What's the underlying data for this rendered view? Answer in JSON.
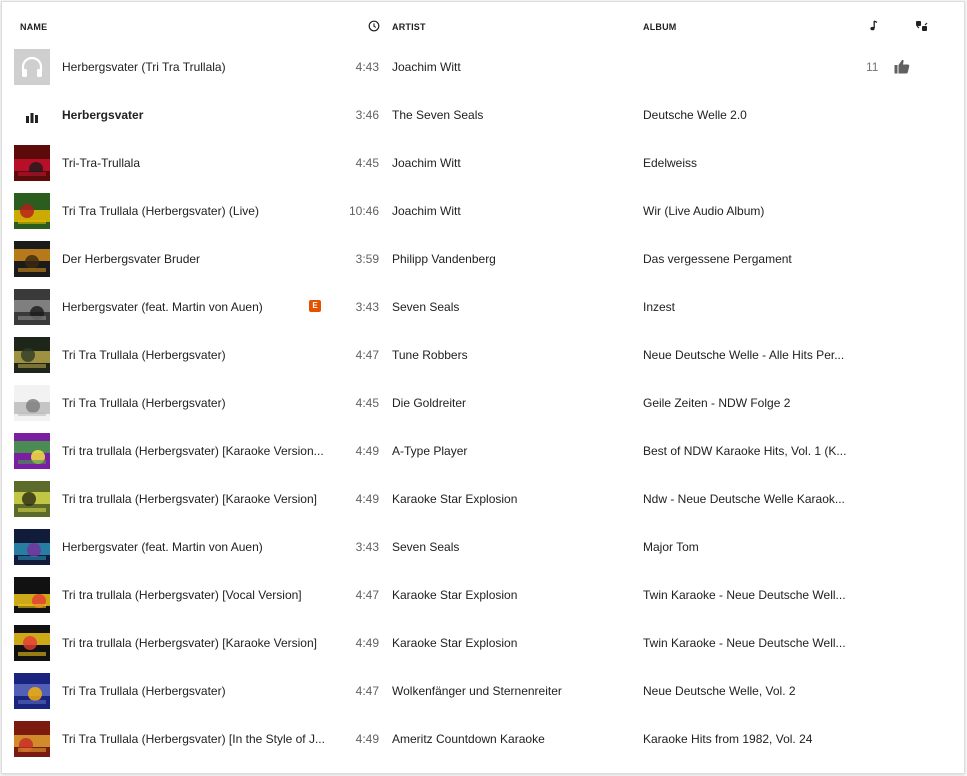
{
  "header": {
    "name_label": "NAME",
    "duration_icon": "clock-icon",
    "artist_label": "ARTIST",
    "album_label": "ALBUM",
    "plays_icon": "music-note-icon",
    "likes_icon": "thumbs-up-down-icon"
  },
  "rows": [
    {
      "name": "Herbergsvater (Tri Tra Trullala)",
      "duration": "4:43",
      "artist": "Joachim Witt",
      "album": "",
      "count": "11",
      "thumb": "headphones-placeholder"
    },
    {
      "name": "Herbergsvater",
      "duration": "3:46",
      "artist": "The Seven Seals",
      "album": "Deutsche Welle 2.0",
      "thumb": "equalizer-now-playing"
    },
    {
      "name": "Tri-Tra-Trullala",
      "duration": "4:45",
      "artist": "Joachim Witt",
      "album": "Edelweiss",
      "thumb": "album-art"
    },
    {
      "name": "Tri Tra Trullala (Herbergsvater) (Live)",
      "duration": "10:46",
      "artist": "Joachim Witt",
      "album": "Wir (Live Audio Album)",
      "thumb": "album-art"
    },
    {
      "name": "Der Herbergsvater Bruder",
      "duration": "3:59",
      "artist": "Philipp Vandenberg",
      "album": "Das vergessene Pergament",
      "thumb": "album-art"
    },
    {
      "name": "Herbergsvater (feat. Martin von Auen)",
      "duration": "3:43",
      "artist": "Seven Seals",
      "album": "Inzest",
      "explicit": "E",
      "thumb": "album-art"
    },
    {
      "name": "Tri Tra Trullala (Herbergsvater)",
      "duration": "4:47",
      "artist": "Tune Robbers",
      "album": "Neue Deutsche Welle - Alle Hits Per...",
      "thumb": "album-art"
    },
    {
      "name": "Tri Tra Trullala (Herbergsvater)",
      "duration": "4:45",
      "artist": "Die Goldreiter",
      "album": "Geile Zeiten - NDW Folge 2",
      "thumb": "album-art"
    },
    {
      "name": "Tri tra trullala (Herbergsvater) [Karaoke Version...",
      "duration": "4:49",
      "artist": "A-Type Player",
      "album": "Best of NDW Karaoke Hits, Vol. 1 (K...",
      "thumb": "album-art"
    },
    {
      "name": "Tri tra trullala (Herbergsvater) [Karaoke Version]",
      "duration": "4:49",
      "artist": "Karaoke Star Explosion",
      "album": "Ndw - Neue Deutsche Welle Karaok...",
      "thumb": "album-art"
    },
    {
      "name": "Herbergsvater (feat. Martin von Auen)",
      "duration": "3:43",
      "artist": "Seven Seals",
      "album": "Major Tom",
      "thumb": "album-art"
    },
    {
      "name": "Tri tra trullala (Herbergsvater) [Vocal Version]",
      "duration": "4:47",
      "artist": "Karaoke Star Explosion",
      "album": "Twin Karaoke - Neue Deutsche Well...",
      "thumb": "album-art"
    },
    {
      "name": "Tri tra trullala (Herbergsvater) [Karaoke Version]",
      "duration": "4:49",
      "artist": "Karaoke Star Explosion",
      "album": "Twin Karaoke - Neue Deutsche Well...",
      "thumb": "album-art"
    },
    {
      "name": "Tri Tra Trullala (Herbergsvater)",
      "duration": "4:47",
      "artist": "Wolkenfänger und Sternenreiter",
      "album": "Neue Deutsche Welle, Vol. 2",
      "thumb": "album-art"
    },
    {
      "name": "Tri Tra Trullala (Herbergsvater) [In the Style of J...",
      "duration": "4:49",
      "artist": "Ameritz Countdown Karaoke",
      "album": "Karaoke Hits from 1982, Vol. 24",
      "thumb": "album-art"
    }
  ],
  "colors": {
    "explicit_badge": "#e65100",
    "placeholder_thumb": "#cfcfcf",
    "text_secondary": "#616161"
  }
}
